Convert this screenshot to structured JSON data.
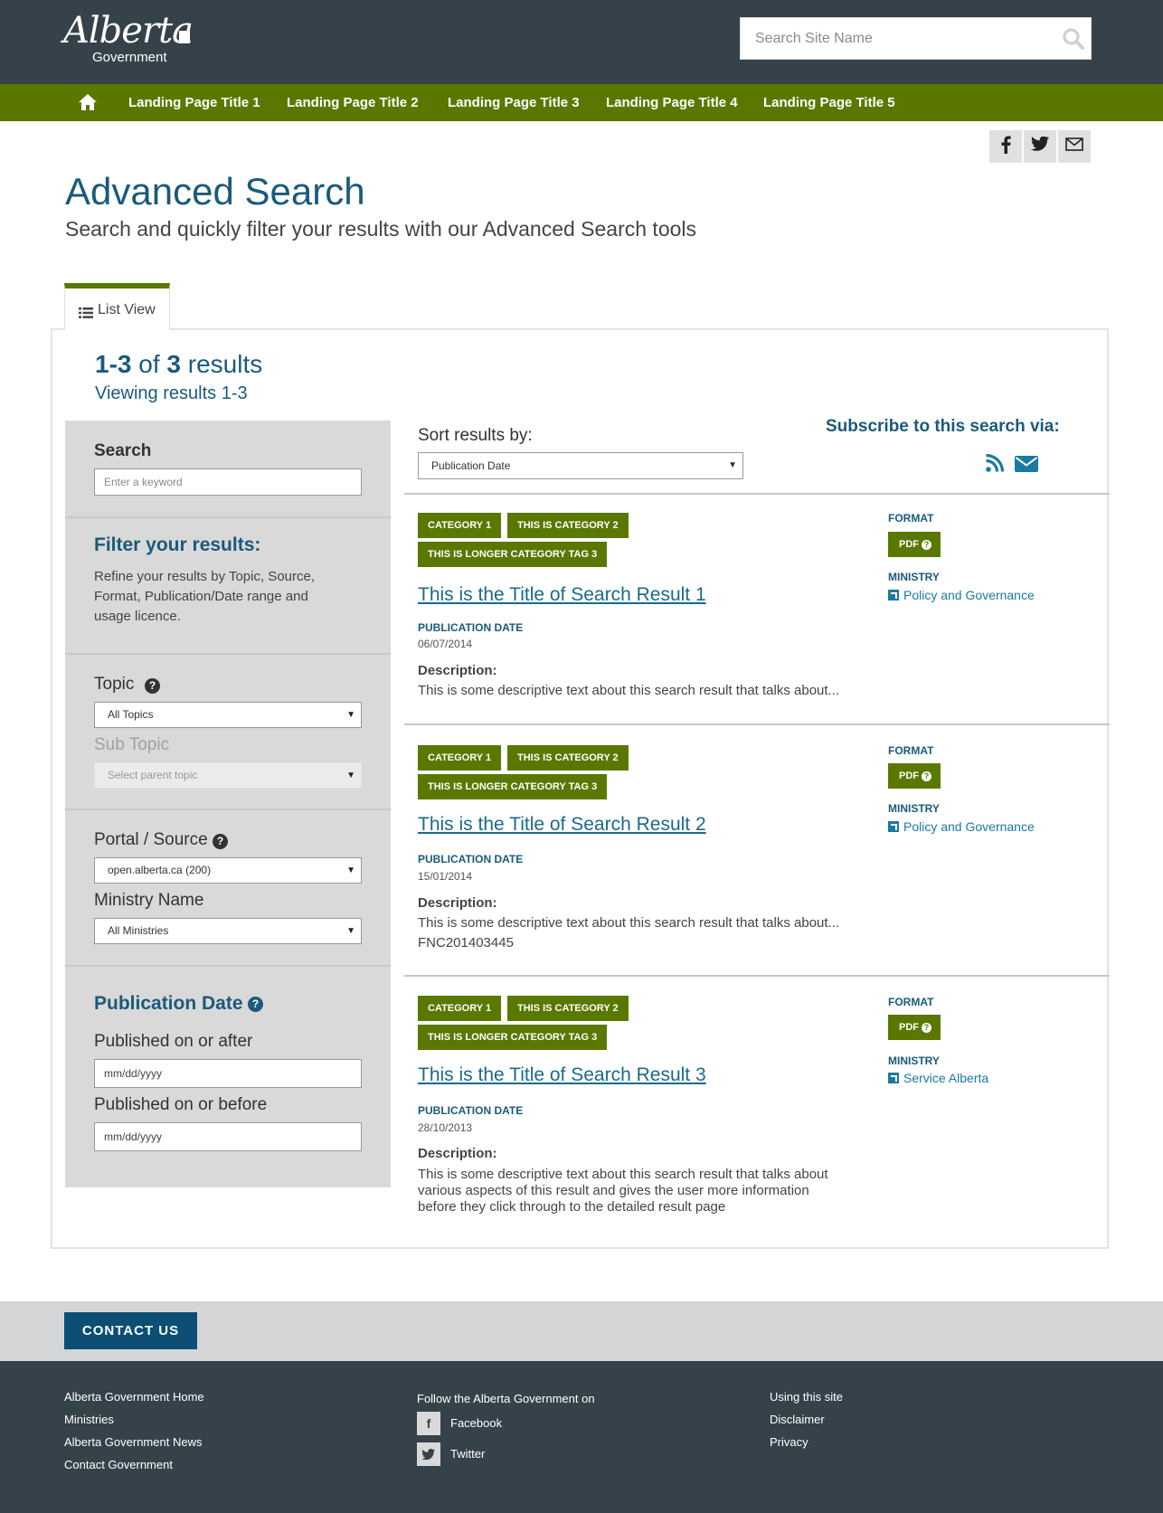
{
  "header": {
    "logo_script": "Alberta",
    "logo_subtext": "Government",
    "search_placeholder": "Search Site Name"
  },
  "nav": {
    "items": [
      "Landing Page Title 1",
      "Landing Page Title 2",
      "Landing Page Title 3",
      "Landing Page Title 4",
      "Landing Page Title 5"
    ]
  },
  "page": {
    "title": "Advanced Search",
    "subtitle": "Search and quickly filter your results with our Advanced Search tools",
    "tab_label": "List View"
  },
  "results": {
    "range": "1-3",
    "of": "of",
    "total": "3",
    "word": "results",
    "viewing": "Viewing results 1-3"
  },
  "sidebar": {
    "search_label": "Search",
    "search_placeholder": "Enter a keyword",
    "filter_heading": "Filter your results:",
    "filter_text": "Refine your results by Topic, Source, Format, Publication/Date range and usage licence.",
    "topic_label": "Topic",
    "topic_value": "All Topics",
    "subtopic_label": "Sub Topic",
    "subtopic_value": "Select parent topic",
    "portal_label": "Portal / Source",
    "portal_value": "open.alberta.ca (200)",
    "ministry_label": "Ministry Name",
    "ministry_value": "All Ministries",
    "pubdate_heading": "Publication Date",
    "after_label": "Published on or after",
    "after_placeholder": "mm/dd/yyyy",
    "before_label": "Published on or before",
    "before_placeholder": "mm/dd/yyyy"
  },
  "sort": {
    "label": "Sort results by:",
    "value": "Publication Date",
    "subscribe_label": "Subscribe to this search via:"
  },
  "result_items": [
    {
      "tags": [
        "CATEGORY 1",
        "THIS IS CATEGORY 2",
        "THIS IS LONGER CATEGORY TAG 3"
      ],
      "title": "This is the Title of Search Result 1",
      "pub_label": "PUBLICATION DATE",
      "pub_date": "06/07/2014",
      "desc_label": "Description:",
      "desc": "This is some descriptive text about this search result that talks about...",
      "extra": "",
      "format_label": "FORMAT",
      "format": "PDF",
      "ministry_label": "MINISTRY",
      "ministry": "Policy and Governance"
    },
    {
      "tags": [
        "CATEGORY 1",
        "THIS IS CATEGORY 2",
        "THIS IS LONGER CATEGORY TAG 3"
      ],
      "title": "This is the Title of Search Result 2",
      "pub_label": "PUBLICATION DATE",
      "pub_date": "15/01/2014",
      "desc_label": "Description:",
      "desc": "This is some descriptive text about this search result that talks about...",
      "extra": "FNC201403445",
      "format_label": "FORMAT",
      "format": "PDF",
      "ministry_label": "MINISTRY",
      "ministry": "Policy and Governance"
    },
    {
      "tags": [
        "CATEGORY 1",
        "THIS IS CATEGORY 2",
        "THIS IS LONGER CATEGORY TAG 3"
      ],
      "title": "This is the Title of Search Result 3",
      "pub_label": "PUBLICATION DATE",
      "pub_date": "28/10/2013",
      "desc_label": "Description:",
      "desc": "This is some descriptive text about this search result that talks about various aspects of this result and gives the user more information before they click through to the detailed result page",
      "extra": "",
      "format_label": "FORMAT",
      "format": "PDF",
      "ministry_label": "MINISTRY",
      "ministry": "Service Alberta"
    }
  ],
  "footer": {
    "contact_label": "CONTACT US",
    "col1": [
      "Alberta Government Home",
      "Ministries",
      "Alberta Government News",
      "Contact Government"
    ],
    "follow_label": "Follow the Alberta Government on",
    "facebook": "Facebook",
    "twitter": "Twitter",
    "col3": [
      "Using this site",
      "Disclaimer",
      "Privacy"
    ]
  },
  "colors": {
    "header_bg": "#36424a",
    "nav_bg": "#5a7800",
    "title_blue": "#1a5a7a",
    "link_blue": "#1a7aa0",
    "tag_green": "#5a7800",
    "contact_btn": "#0c4e74"
  },
  "icons": [
    "search-icon",
    "home-icon",
    "facebook-icon",
    "twitter-icon",
    "email-icon",
    "list-icon",
    "help-icon",
    "rss-icon",
    "external-link-icon",
    "chevron-down-icon"
  ]
}
